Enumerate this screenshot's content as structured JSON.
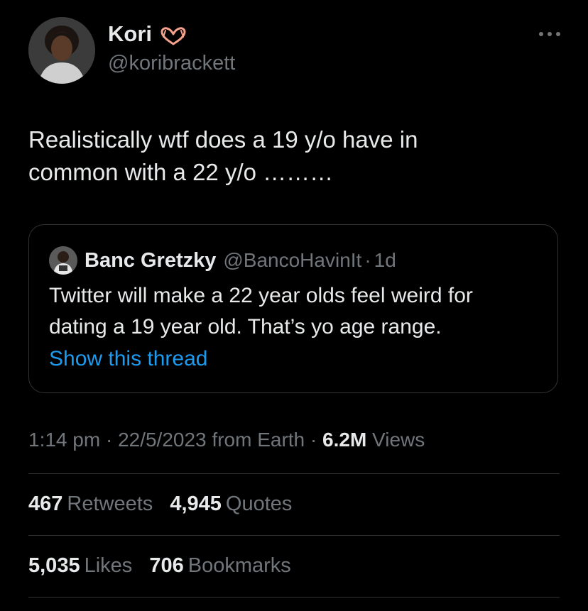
{
  "author": {
    "display_name": "Kori",
    "name_emoji": "heart-hands-emoji",
    "handle": "@koribrackett"
  },
  "more_icon": "more-horizontal-icon",
  "tweet": {
    "text_line1": "Realistically wtf does a 19 y/o have in",
    "text_line2": "common with a 22 y/o ………"
  },
  "quote": {
    "display_name": "Banc Gretzky",
    "handle": "@BancoHavinIt",
    "separator": "·",
    "time": "1d",
    "text_line1": "Twitter will make a 22 year olds feel weird for",
    "text_line2": "dating a 19 year old. That’s yo age range.",
    "show_thread": "Show this thread"
  },
  "meta": {
    "time": "1:14 pm",
    "sep1": "·",
    "date": "22/5/2023",
    "source": "from Earth",
    "sep2": "·",
    "views_count": "6.2M",
    "views_label": "Views"
  },
  "stats": {
    "retweets_count": "467",
    "retweets_label": "Retweets",
    "quotes_count": "4,945",
    "quotes_label": "Quotes",
    "likes_count": "5,035",
    "likes_label": "Likes",
    "bookmarks_count": "706",
    "bookmarks_label": "Bookmarks"
  },
  "colors": {
    "background": "#000000",
    "text_primary": "#e7e9ea",
    "text_secondary": "#71767b",
    "link": "#1d9bf0",
    "border": "#2f3336",
    "heart_emoji": "#f4a28c"
  }
}
